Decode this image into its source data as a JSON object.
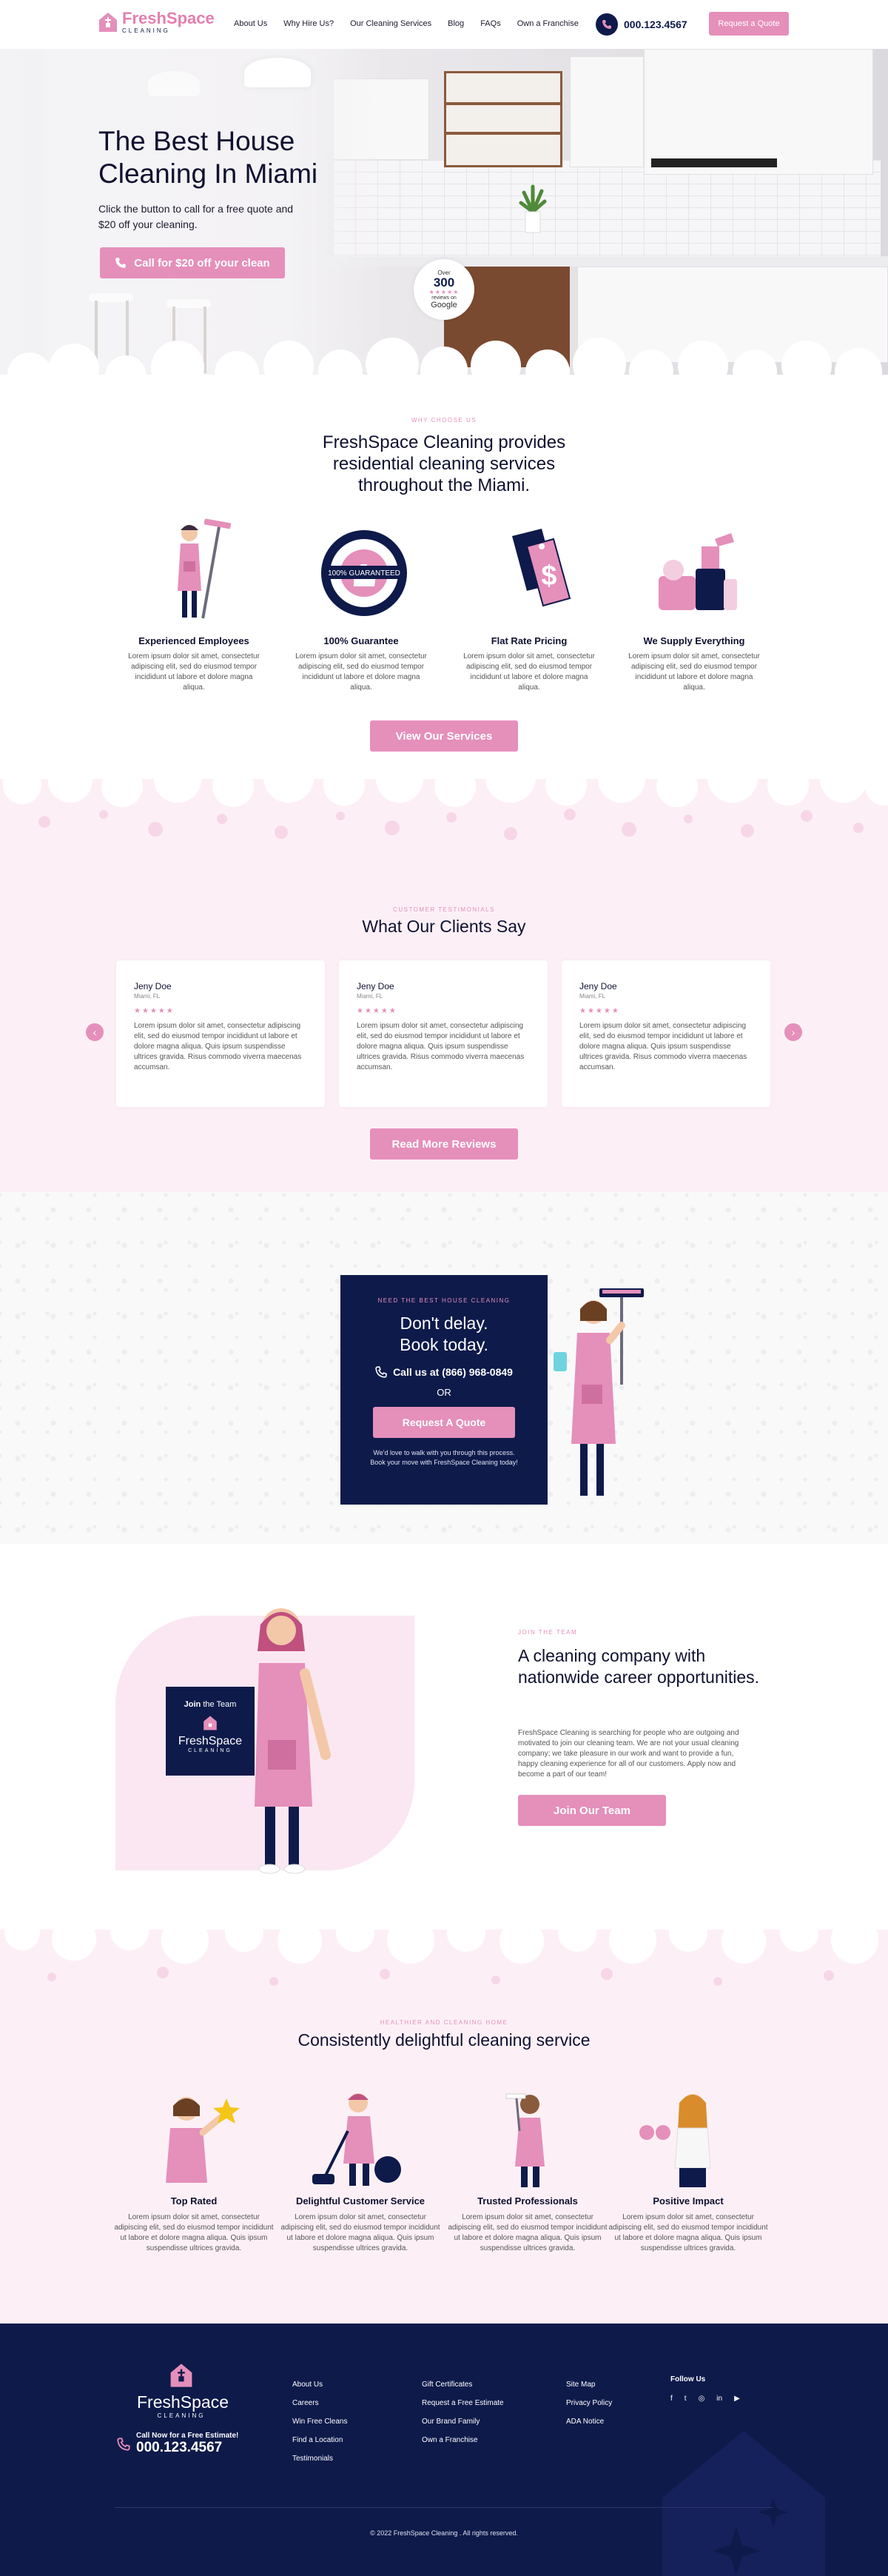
{
  "header": {
    "logo_brand": "FreshSpace",
    "logo_sub": "CLEANING",
    "nav": [
      "About Us",
      "Why Hire Us?",
      "Our Cleaning Services",
      "Blog",
      "FAQs",
      "Own a Franchise"
    ],
    "phone": "000.123.4567",
    "quote_button": "Request a Quote"
  },
  "hero": {
    "title": "The Best House Cleaning In Miami",
    "subtitle": "Click the button to call for a free quote and $20 off your cleaning.",
    "cta": "Call for $20 off your clean",
    "badge": {
      "over": "Over",
      "count": "300",
      "stars": "★★★★★",
      "reviews": "reviews on",
      "google": "Google"
    }
  },
  "why": {
    "eyebrow": "WHY CHOOSE US",
    "title": "FreshSpace Cleaning provides residential cleaning services throughout the Miami.",
    "features": [
      {
        "title": "Experienced Employees",
        "text": "Lorem ipsum dolor sit amet, consectetur adipiscing elit, sed do eiusmod tempor incididunt ut labore et dolore magna aliqua.",
        "icon": "cleaner-with-mop-icon"
      },
      {
        "title": "100% Guarantee",
        "text": "Lorem ipsum dolor sit amet, consectetur adipiscing elit, sed do eiusmod tempor incididunt ut labore et dolore magna aliqua.",
        "icon": "guarantee-seal-icon"
      },
      {
        "title": "Flat Rate Pricing",
        "text": "Lorem ipsum dolor sit amet, consectetur adipiscing elit, sed do eiusmod tempor incididunt ut labore et dolore magna aliqua.",
        "icon": "price-tag-icon"
      },
      {
        "title": "We Supply Everything",
        "text": "Lorem ipsum dolor sit amet, consectetur adipiscing elit, sed do eiusmod tempor incididunt ut labore et dolore magna aliqua.",
        "icon": "cleaning-supplies-icon"
      }
    ],
    "button": "View Our Services"
  },
  "testimonials": {
    "eyebrow": "CUSTOMER TESTIMONIALS",
    "title": "What Our Clients Say",
    "reviews": [
      {
        "name": "Jeny Doe",
        "location": "Miami, FL",
        "stars": "★★★★★",
        "text": "Lorem ipsum dolor sit amet, consectetur adipiscing elit, sed do eiusmod tempor incididunt ut labore et dolore magna aliqua. Quis ipsum suspendisse ultrices gravida. Risus commodo viverra maecenas accumsan."
      },
      {
        "name": "Jeny Doe",
        "location": "Miami, FL",
        "stars": "★★★★★",
        "text": "Lorem ipsum dolor sit amet, consectetur adipiscing elit, sed do eiusmod tempor incididunt ut labore et dolore magna aliqua. Quis ipsum suspendisse ultrices gravida. Risus commodo viverra maecenas accumsan."
      },
      {
        "name": "Jeny Doe",
        "location": "Miami, FL",
        "stars": "★★★★★",
        "text": "Lorem ipsum dolor sit amet, consectetur adipiscing elit, sed do eiusmod tempor incididunt ut labore et dolore magna aliqua. Quis ipsum suspendisse ultrices gravida. Risus commodo viverra maecenas accumsan."
      }
    ],
    "button": "Read More Reviews"
  },
  "cta": {
    "eyebrow": "NEED THE BEST HOUSE CLEANING",
    "title_line1": "Don't delay.",
    "title_line2": "Book today.",
    "phone": "Call us at (866) 968-0849",
    "or": "OR",
    "button": "Request A Quote",
    "small": "We'd love to walk with you through this process. Book your move with FreshSpace Cleaning today!"
  },
  "careers": {
    "join_title_a": "Join",
    "join_title_b": "the Team",
    "eyebrow": "JOIN THE TEAM",
    "title": "A cleaning company with nationwide career opportunities.",
    "text": "FreshSpace Cleaning is searching for people who are outgoing and motivated to join our cleaning team. We are not your usual cleaning company; we take pleasure in our work and want to provide a fun, happy cleaning experience for all of our customers. Apply now and become a part of our team!",
    "button": "Join Our Team"
  },
  "delight": {
    "eyebrow": "HEALTHIER AND CLEANING HOME",
    "title": "Consistently delightful cleaning service",
    "items": [
      {
        "title": "Top Rated",
        "text": "Lorem ipsum dolor sit amet, consectetur adipiscing elit, sed do eiusmod tempor incididunt ut labore et dolore magna aliqua. Quis ipsum suspendisse ultrices gravida."
      },
      {
        "title": "Delightful Customer Service",
        "text": "Lorem ipsum dolor sit amet, consectetur adipiscing elit, sed do eiusmod tempor incididunt ut labore et dolore magna aliqua. Quis ipsum suspendisse ultrices gravida."
      },
      {
        "title": "Trusted Professionals",
        "text": "Lorem ipsum dolor sit amet, consectetur adipiscing elit, sed do eiusmod tempor incididunt ut labore et dolore magna aliqua. Quis ipsum suspendisse ultrices gravida."
      },
      {
        "title": "Positive Impact",
        "text": "Lorem ipsum dolor sit amet, consectetur adipiscing elit, sed do eiusmod tempor incididunt ut labore et dolore magna aliqua. Quis ipsum suspendisse ultrices gravida."
      }
    ]
  },
  "footer": {
    "brand": "FreshSpace",
    "sub": "CLEANING",
    "call_label": "Call Now for a Free Estimate!",
    "phone": "000.123.4567",
    "col1": [
      "About Us",
      "Careers",
      "Win Free Cleans",
      "Find a Location",
      "Testimonials"
    ],
    "col2": [
      "Gift Certificates",
      "Request a Free Estimate",
      "Our Brand Family",
      "Own a Franchise"
    ],
    "col3": [
      "Site Map",
      "Privacy Policy",
      "ADA Notice"
    ],
    "follow": "Follow Us",
    "socials": [
      "f",
      "t",
      "◎",
      "in",
      "▶"
    ],
    "copyright": "© 2022 FreshSpace Cleaning . All rights reserved."
  },
  "colors": {
    "pink": "#e58fbb",
    "navy": "#0e1a4a",
    "light_pink": "#fcf0f6"
  }
}
